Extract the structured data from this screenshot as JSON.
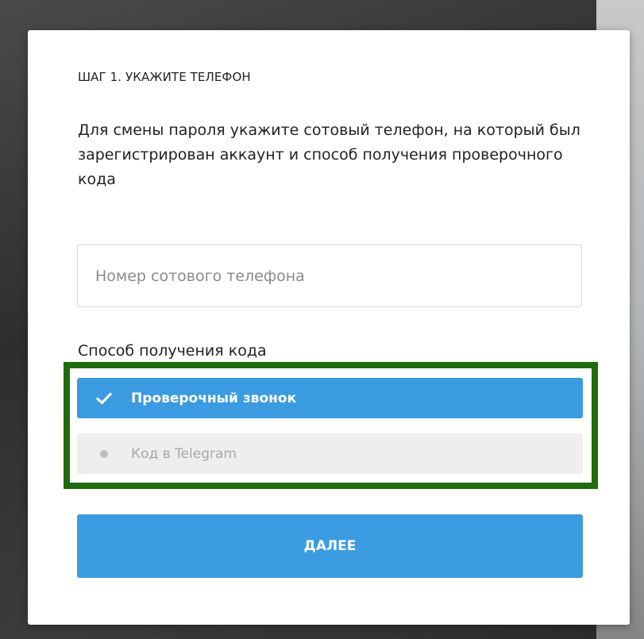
{
  "modal": {
    "step_title": "ШАГ 1. УКАЖИТЕ ТЕЛЕФОН",
    "description": "Для смены пароля укажите сотовый телефон, на который был зарегистрирован аккаунт и способ получения проверочного кода",
    "phone_input": {
      "placeholder": "Номер сотового телефона",
      "value": ""
    },
    "method_label": "Способ получения кода",
    "methods": [
      {
        "label": "Проверочный звонок",
        "selected": true,
        "icon": "check-icon"
      },
      {
        "label": "Код в Telegram",
        "selected": false,
        "icon": "dot-icon"
      }
    ],
    "submit_label": "ДАЛЕЕ"
  },
  "colors": {
    "accent": "#3b9be0",
    "highlight_border": "#1f6b0f",
    "unselected_bg": "#eeeeee"
  }
}
